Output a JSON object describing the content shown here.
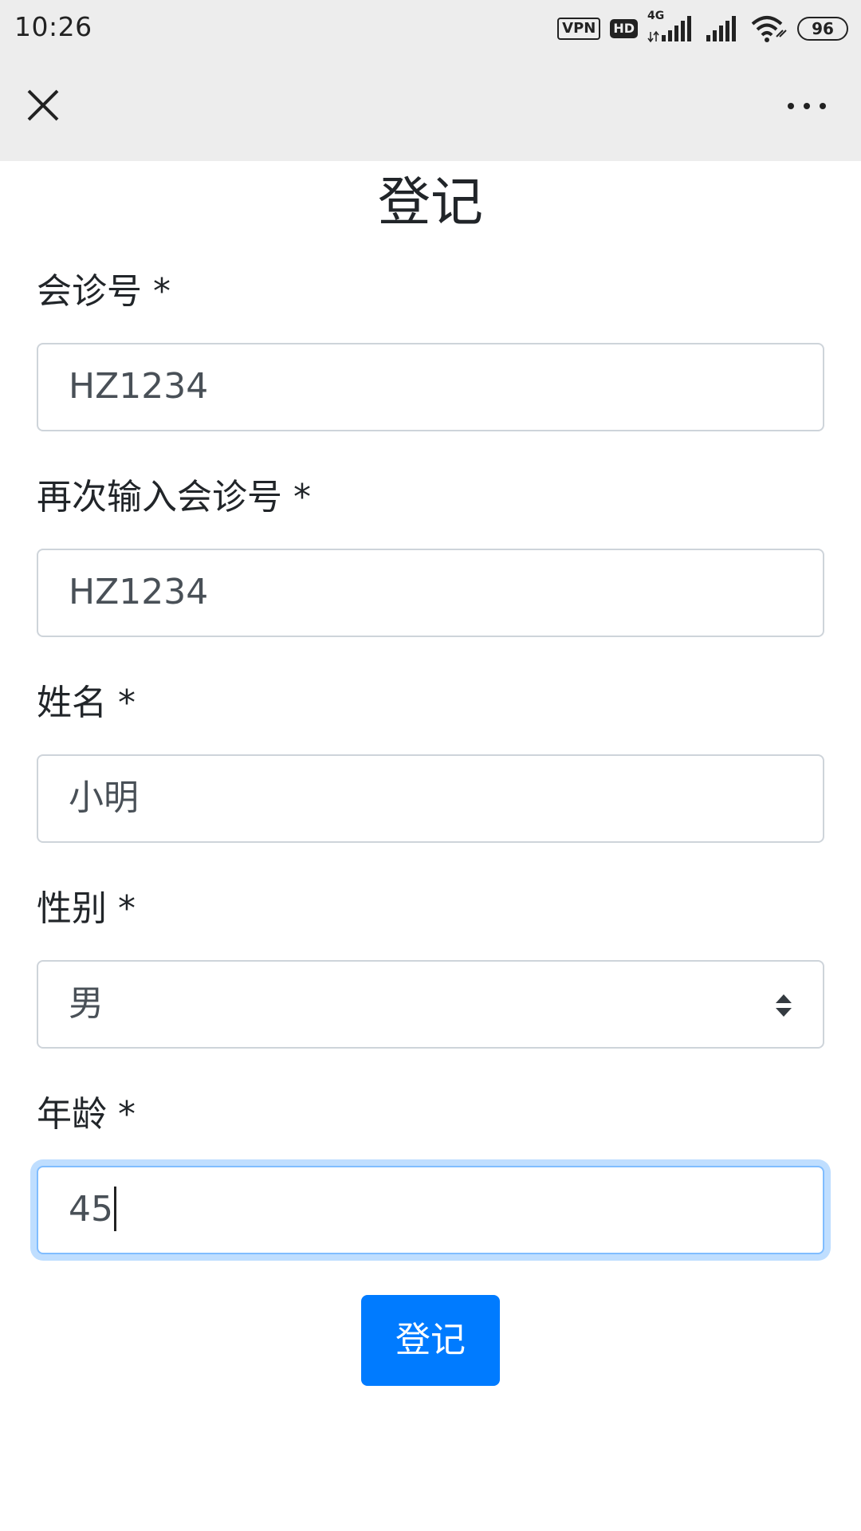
{
  "status_bar": {
    "time": "10:26",
    "vpn_label": "VPN",
    "hd_label": "HD",
    "network_label": "4G",
    "battery_level": "96"
  },
  "nav": {
    "close_icon": "close-icon",
    "more_icon": "more-icon"
  },
  "form": {
    "title": "登记",
    "fields": [
      {
        "label": "会诊号 *",
        "value": "HZ1234"
      },
      {
        "label": "再次输入会诊号 *",
        "value": "HZ1234"
      },
      {
        "label": "姓名 *",
        "value": "小明"
      },
      {
        "label": "性别 *",
        "value": "男"
      },
      {
        "label": "年龄 *",
        "value": "45"
      }
    ],
    "submit_label": "登记"
  },
  "colors": {
    "primary": "#007bff",
    "focus_border": "#80bdff",
    "input_border": "#ced4da",
    "bar_background": "#ededed"
  }
}
